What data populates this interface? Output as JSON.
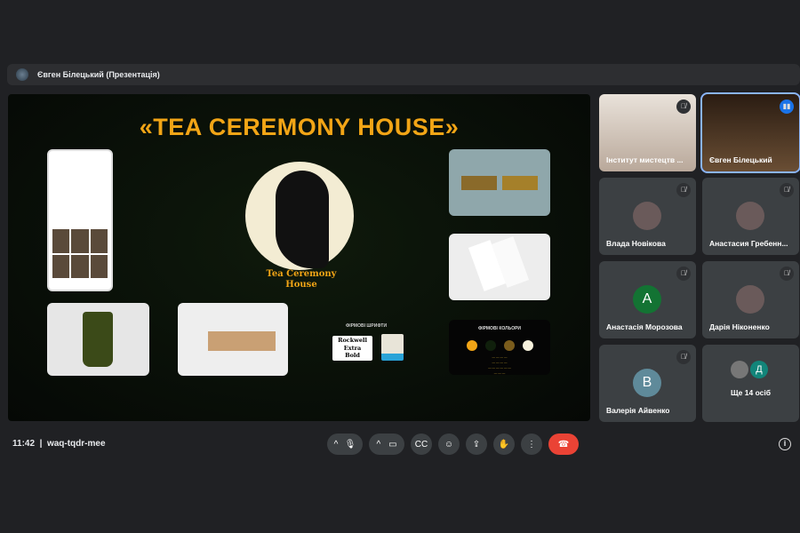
{
  "presenter_bar": {
    "label": "Євген Білецький (Презентація)"
  },
  "slide": {
    "title": "«TEA CEREMONY HOUSE»",
    "logo_line1": "Tea Ceremony",
    "logo_line2": "House",
    "fonts_title": "ФІРМОВІ ШРИФТИ",
    "font_sample": [
      "Rockwell",
      "Extra",
      "Bold"
    ],
    "colors_title": "ФІРМОВІ КОЛЬОРИ",
    "brand_colors": [
      "#f2a516",
      "#10200c",
      "#7a5c1c",
      "#f6f1dc"
    ]
  },
  "participants": [
    {
      "name": "Інститут мистецтв ...",
      "muted": true,
      "video": true
    },
    {
      "name": "Євген Білецький",
      "speaking": true,
      "video": true
    },
    {
      "name": "Влада Новікова",
      "muted": true
    },
    {
      "name": "Анастасия Гребенн...",
      "muted": true
    },
    {
      "name": "Анастасія Морозова",
      "muted": true,
      "initial": "А",
      "color": "#137333"
    },
    {
      "name": "Дарія Ніконенко",
      "muted": true
    },
    {
      "name": "Валерія Айвенко",
      "muted": true,
      "initial": "В",
      "color": "#5f8a9a"
    },
    {
      "name": "Ще 14 осіб",
      "initial": "Д",
      "color": "#12857a"
    }
  ],
  "bottom": {
    "time": "11:42",
    "meeting_code": "waq-tqdr-mee"
  }
}
